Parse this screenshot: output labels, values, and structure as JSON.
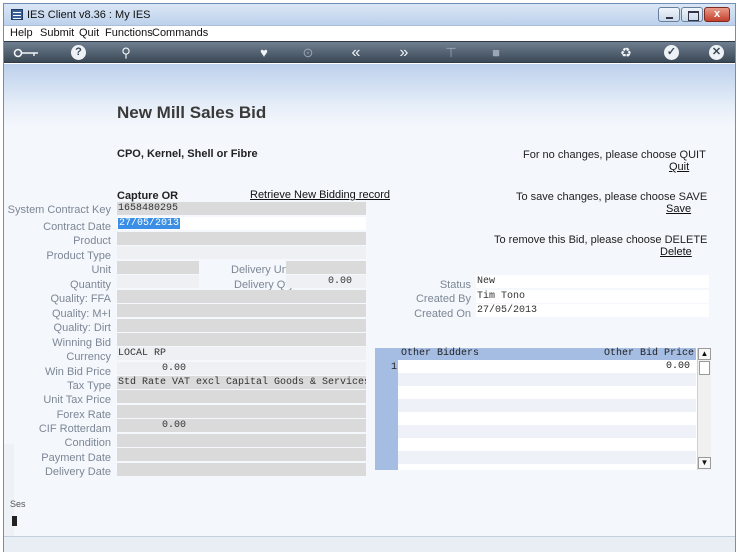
{
  "window": {
    "title": "IES Client v8.36 : My IES",
    "close_glyph": "x"
  },
  "menu": [
    "Help",
    "Submit",
    "Quit",
    "Functions",
    "Commands"
  ],
  "toolbar": {
    "help_glyph": "?",
    "search_glyph": "⚲",
    "heart_glyph": "♥",
    "clock_glyph": "⊙",
    "back_glyph": "«",
    "forward_glyph": "»",
    "text_glyph": "⊤",
    "square_glyph": "■",
    "recycle_glyph": "♻",
    "check_glyph": "✓",
    "close_glyph": "✕"
  },
  "page": {
    "title": "New Mill Sales Bid",
    "subtitle": "CPO, Kernel, Shell or Fibre",
    "capture_label": "Capture OR",
    "retrieve_link": "Retrieve New Bidding record"
  },
  "actions": {
    "quit_info": "For no changes, please choose QUIT",
    "quit_link": "Quit",
    "save_info": "To save changes, please choose SAVE",
    "save_link": "Save",
    "delete_info": "To remove this Bid,  please choose  DELETE",
    "delete_link": "Delete"
  },
  "form": {
    "system_contract_key": {
      "label": "System Contract Key",
      "value": "1658480295"
    },
    "contract_date": {
      "label": "Contract Date",
      "value": "27/05/2013"
    },
    "product": {
      "label": "Product",
      "value": ""
    },
    "product_type": {
      "label": "Product Type",
      "value": ""
    },
    "unit": {
      "label": "Unit",
      "value": ""
    },
    "delivery_unit": {
      "label": "Delivery Unit",
      "value": ""
    },
    "quantity": {
      "label": "Quantity",
      "value": ""
    },
    "delivery_qty": {
      "label": "Delivery Qty",
      "value": "0.00"
    },
    "quality_ffa": {
      "label": "Quality: FFA",
      "value": ""
    },
    "quality_mi": {
      "label": "Quality: M+I",
      "value": ""
    },
    "quality_dirt": {
      "label": "Quality: Dirt",
      "value": ""
    },
    "winning_bid": {
      "label": "Winning Bid",
      "value": ""
    },
    "currency": {
      "label": "Currency",
      "value": "LOCAL RP"
    },
    "win_bid_price": {
      "label": "Win Bid Price",
      "value": "0.00"
    },
    "tax_type": {
      "label": "Tax Type",
      "value": "Std Rate VAT excl Capital Goods & Services"
    },
    "unit_tax_price": {
      "label": "Unit Tax Price",
      "value": ""
    },
    "forex_rate": {
      "label": "Forex Rate",
      "value": ""
    },
    "cif_rotterdam": {
      "label": "CIF Rotterdam",
      "value": "0.00"
    },
    "condition": {
      "label": "Condition",
      "value": ""
    },
    "payment_date": {
      "label": "Payment Date",
      "value": ""
    },
    "delivery_date": {
      "label": "Delivery Date",
      "value": ""
    }
  },
  "status": {
    "status": {
      "label": "Status",
      "value": "New"
    },
    "created_by": {
      "label": "Created By",
      "value": "Tim Tono"
    },
    "created_on": {
      "label": "Created On",
      "value": "27/05/2013"
    }
  },
  "bidders_grid": {
    "columns": [
      "Other Bidders",
      "Other Bid Price"
    ],
    "rows": [
      {
        "index": "1",
        "bidder": "",
        "price": "0.00"
      }
    ]
  },
  "scroll": {
    "up": "▲",
    "down": "▼"
  },
  "leftframe": {
    "text": "Ses"
  }
}
